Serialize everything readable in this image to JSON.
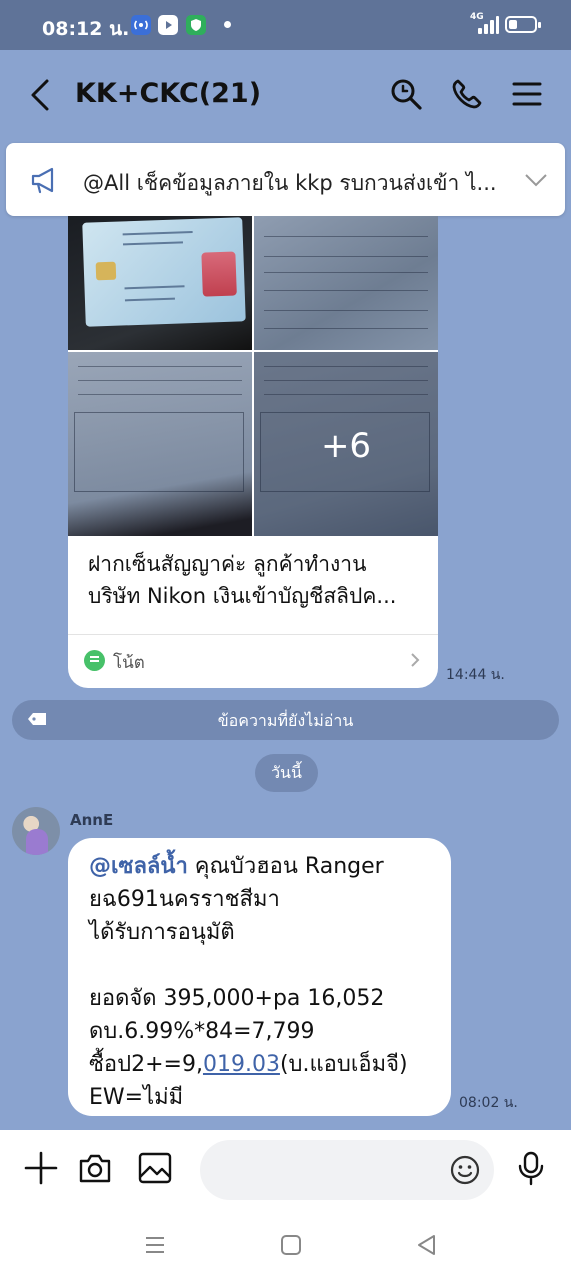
{
  "status_bar": {
    "time": "08:12 น.",
    "network": "4G",
    "app_icons": [
      "radio-icon",
      "youtube-icon",
      "shield-icon"
    ]
  },
  "header": {
    "title": "KK+CKC(21)",
    "icons": [
      "back-arrow-icon",
      "search-icon",
      "phone-icon",
      "menu-icon"
    ]
  },
  "announcement": {
    "text": "@All  เช็คข้อมูลภายใน kkp รบกวนส่งเข้า ไ..."
  },
  "photo_message": {
    "more_count": "+6",
    "caption_line1": "ฝากเซ็นสัญญาค่ะ ลูกค้าทำงาน",
    "caption_line2": "บริษัท Nikon เงินเข้าบัญชีสลิปค...",
    "note_label": "โน้ต",
    "time": "14:44 น."
  },
  "unread_divider": {
    "label": "ข้อความที่ยังไม่อ่าน"
  },
  "date_chip": {
    "label": "วันนี้"
  },
  "message": {
    "sender": "AnnE",
    "mention": "@เซลล์น้ำ",
    "line1_rest": " คุณบัวฮอน Ranger",
    "line2": "ยฉ691นครราชสีมา",
    "line3": "ได้รับการอนุมัติ",
    "line5": "ยอดจัด 395,000+pa 16,052",
    "line6": "ดบ.6.99%*84=7,799",
    "line7_prefix": "ซื้อป2+=9,",
    "line7_link": "019.03",
    "line7_suffix": "(บ.แอบเอ็มจี)",
    "line8": "EW=ไม่มี",
    "time": "08:02 น."
  },
  "input_bar": {
    "placeholder": "",
    "icons": [
      "plus-icon",
      "camera-icon",
      "image-icon",
      "emoji-icon",
      "microphone-icon"
    ]
  },
  "nav_bar": {
    "icons": [
      "recent-apps-icon",
      "home-icon",
      "back-icon"
    ]
  },
  "colors": {
    "background": "#8aa3cf",
    "status_bar": "#5f7398",
    "pill": "#7389b2",
    "mention": "#3f63a8",
    "note_green": "#47c169"
  }
}
